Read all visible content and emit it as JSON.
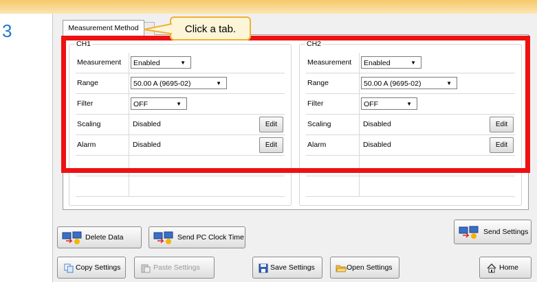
{
  "step_number": "3",
  "tab": {
    "active_label": "Measurement Method"
  },
  "callout": {
    "text": "Click a tab."
  },
  "channels": [
    {
      "title": "CH1",
      "rows": [
        {
          "label": "Measurement",
          "value": "Enabled",
          "kind": "dropdown"
        },
        {
          "label": "Range",
          "value": "50.00 A (9695-02)",
          "kind": "dropdown"
        },
        {
          "label": "Filter",
          "value": "OFF",
          "kind": "dropdown"
        },
        {
          "label": "Scaling",
          "value": "Disabled",
          "kind": "edit",
          "button": "Edit"
        },
        {
          "label": "Alarm",
          "value": "Disabled",
          "kind": "edit",
          "button": "Edit"
        }
      ]
    },
    {
      "title": "CH2",
      "rows": [
        {
          "label": "Measurement",
          "value": "Enabled",
          "kind": "dropdown"
        },
        {
          "label": "Range",
          "value": "50.00 A (9695-02)",
          "kind": "dropdown"
        },
        {
          "label": "Filter",
          "value": "OFF",
          "kind": "dropdown"
        },
        {
          "label": "Scaling",
          "value": "Disabled",
          "kind": "edit",
          "button": "Edit"
        },
        {
          "label": "Alarm",
          "value": "Disabled",
          "kind": "edit",
          "button": "Edit"
        }
      ]
    }
  ],
  "buttons": {
    "delete_data": "Delete Data",
    "send_pc_clock": "Send PC Clock Time",
    "send_settings": "Send Settings",
    "copy_settings": "Copy Settings",
    "paste_settings": "Paste Settings",
    "save_settings": "Save Settings",
    "open_settings": "Open Settings",
    "home": "Home"
  },
  "colors": {
    "highlight": "#ee1111",
    "callout_border": "#f0b030",
    "step_number": "#1f78d0"
  }
}
